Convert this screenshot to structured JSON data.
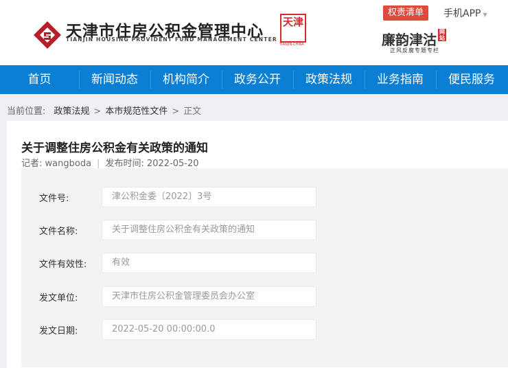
{
  "header": {
    "org_name_cn": "天津市住房公积金管理中心",
    "org_name_en": "TIANJIN HOUSING PROVIDENT FUND MANAGEMENT CENTER",
    "seal_text": "天津",
    "seal_sub": "TIANJIN·CHINA",
    "duty_list_button": "权责清单",
    "mobile_app": "手机APP",
    "lianyun_title": "廉韵津沽",
    "lianyun_badge": "网站",
    "lianyun_sub": "正风反腐专题专栏"
  },
  "nav": [
    "首页",
    "新闻动态",
    "机构简介",
    "政务公开",
    "政策法规",
    "业务指南",
    "便民服务"
  ],
  "breadcrumb": {
    "label": "当前位置:",
    "items": [
      "政策法规",
      "本市规范性文件"
    ],
    "current": "正文"
  },
  "article": {
    "title": "关于调整住房公积金有关政策的通知",
    "author_label": "记者:",
    "author": "wangboda",
    "date_label": "发布时间:",
    "date": "2022-05-20"
  },
  "form": [
    {
      "label": "文件号:",
      "value": "津公积金委〔2022〕3号"
    },
    {
      "label": "文件名称:",
      "value": "关于调整住房公积金有关政策的通知"
    },
    {
      "label": "文件有效性:",
      "value": "有效"
    },
    {
      "label": "发文单位:",
      "value": "天津市住房公积金管理委员会办公室"
    },
    {
      "label": "发文日期:",
      "value": "2022-05-20 00:00:00.0"
    }
  ]
}
